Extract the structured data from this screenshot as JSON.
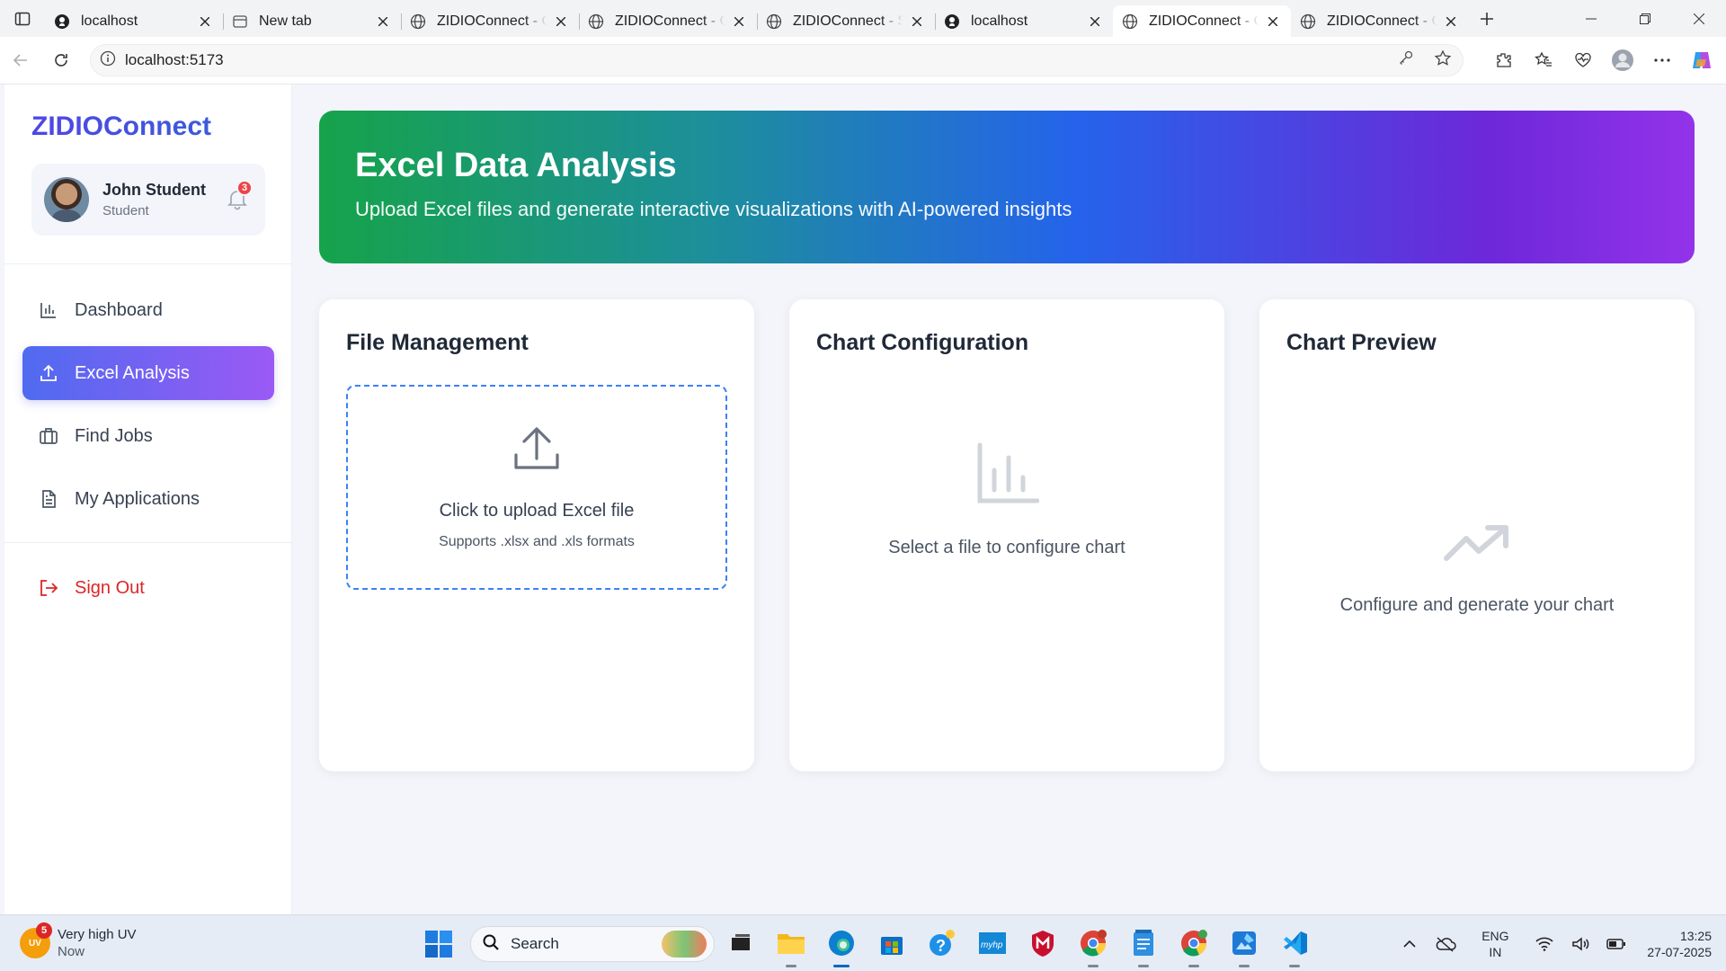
{
  "browser": {
    "tabs": [
      {
        "title": "localhost",
        "favicon": "github-icon",
        "active": false
      },
      {
        "title": "New tab",
        "favicon": "newtab-icon",
        "active": false
      },
      {
        "title": "ZIDIOConnect - Co",
        "favicon": "globe-icon",
        "active": false
      },
      {
        "title": "ZIDIOConnect - Co",
        "favicon": "globe-icon",
        "active": false
      },
      {
        "title": "ZIDIOConnect - St",
        "favicon": "globe-icon",
        "active": false
      },
      {
        "title": "localhost",
        "favicon": "github-icon",
        "active": false
      },
      {
        "title": "ZIDIOConnect - Co",
        "favicon": "globe-icon",
        "active": true
      },
      {
        "title": "ZIDIOConnect - Co",
        "favicon": "globe-icon",
        "active": false
      }
    ],
    "url": "localhost:5173"
  },
  "sidebar": {
    "brand": "ZIDIOConnect",
    "user": {
      "name": "John Student",
      "role": "Student",
      "notifications": "3"
    },
    "nav": [
      {
        "label": "Dashboard",
        "icon": "bar-chart-icon",
        "active": false
      },
      {
        "label": "Excel Analysis",
        "icon": "upload-icon",
        "active": true
      },
      {
        "label": "Find Jobs",
        "icon": "briefcase-icon",
        "active": false
      },
      {
        "label": "My Applications",
        "icon": "document-icon",
        "active": false
      }
    ],
    "signout": "Sign Out"
  },
  "hero": {
    "title": "Excel Data Analysis",
    "subtitle": "Upload Excel files and generate interactive visualizations with AI-powered insights"
  },
  "cards": {
    "file": {
      "title": "File Management",
      "upload_label": "Click to upload Excel file",
      "upload_hint": "Supports .xlsx and .xls formats"
    },
    "config": {
      "title": "Chart Configuration",
      "placeholder": "Select a file to configure chart"
    },
    "preview": {
      "title": "Chart Preview",
      "placeholder": "Configure and generate your chart"
    }
  },
  "taskbar": {
    "weather": {
      "title": "Very high UV",
      "sub": "Now",
      "badge": "5",
      "icon_text": "UV"
    },
    "search": "Search",
    "lang": {
      "line1": "ENG",
      "line2": "IN"
    },
    "clock": {
      "time": "13:25",
      "date": "27-07-2025"
    }
  },
  "colors": {
    "brand": "#4f46e5",
    "active_nav_start": "#4f6bf0",
    "active_nav_end": "#9b59f5",
    "signout": "#dc2626",
    "dropzone_border": "#3b82f6"
  }
}
